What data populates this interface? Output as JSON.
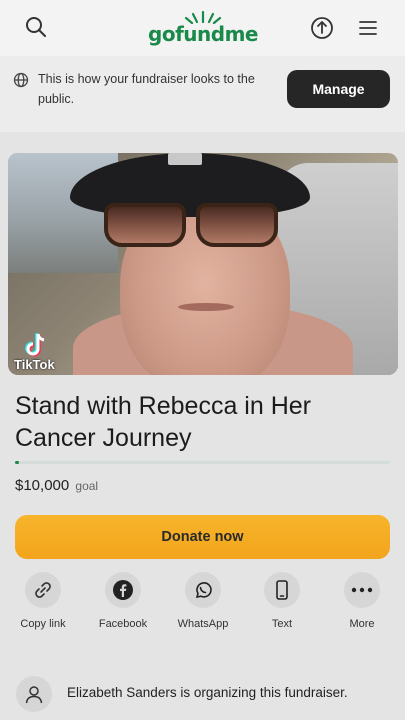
{
  "header": {
    "logo_text": "gofundme",
    "search_icon": "search-icon",
    "share_icon": "upload-icon",
    "menu_icon": "hamburger-menu-icon"
  },
  "preview_notice": {
    "icon": "globe-icon",
    "text": "This is how your fundraiser looks to the public.",
    "manage_label": "Manage"
  },
  "hero": {
    "overlay_label": "TikTok"
  },
  "fundraiser": {
    "title": "Stand with Rebecca in Her Cancer Journey",
    "amount": "$10,000",
    "goal_word": "goal",
    "progress_fraction": 0.01
  },
  "donate_label": "Donate now",
  "share_options": [
    {
      "label": "Copy link",
      "icon": "link-icon"
    },
    {
      "label": "Facebook",
      "icon": "facebook-icon"
    },
    {
      "label": "WhatsApp",
      "icon": "whatsapp-icon"
    },
    {
      "label": "Text",
      "icon": "phone-icon"
    },
    {
      "label": "More",
      "icon": "more-dots-icon"
    }
  ],
  "organizer": {
    "icon": "user-icon",
    "text": "Elizabeth Sanders is organizing this fundraiser."
  },
  "colors": {
    "brand_green": "#1a8a4a",
    "donate_orange": "#f5a623",
    "manage_dark": "#262626"
  }
}
